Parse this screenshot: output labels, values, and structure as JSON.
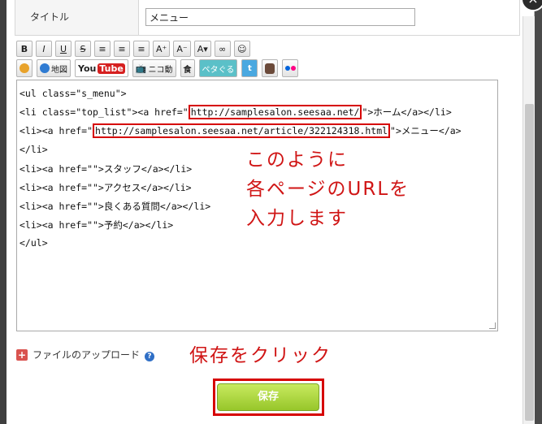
{
  "title_field": {
    "label": "タイトル",
    "value": "メニュー"
  },
  "toolbar": {
    "row1": [
      {
        "name": "bold-button",
        "label": "B",
        "cls": "bold"
      },
      {
        "name": "italic-button",
        "label": "I",
        "cls": "italic"
      },
      {
        "name": "underline-button",
        "label": "U",
        "cls": "underline"
      },
      {
        "name": "strikethrough-button",
        "label": "S",
        "cls": "strike"
      },
      {
        "name": "align-left-button",
        "label": "≡",
        "cls": ""
      },
      {
        "name": "align-center-button",
        "label": "≡",
        "cls": ""
      },
      {
        "name": "align-right-button",
        "label": "≡",
        "cls": ""
      },
      {
        "name": "font-size-up-button",
        "label": "A⁺",
        "cls": ""
      },
      {
        "name": "font-size-down-button",
        "label": "A⁻",
        "cls": ""
      },
      {
        "name": "font-color-button",
        "label": "A▾",
        "cls": ""
      },
      {
        "name": "link-button",
        "label": "∞",
        "cls": ""
      },
      {
        "name": "emoji-button",
        "label": "☺",
        "cls": ""
      }
    ],
    "row2": {
      "ribbon_icon": "award-ribbon-icon",
      "map_label": "地図",
      "youtube_you": "You",
      "youtube_tube": "Tube",
      "nicovideo_label": "ニコ動",
      "food_label": "食",
      "petagogu_label": "ペタぐる",
      "twitter_icon": "t",
      "instagram_icon": "instagram-icon",
      "flickr_icon": "flickr-icon"
    }
  },
  "editor": {
    "lines": [
      "<ul class=\"s_menu\">",
      "<li class=\"top_list\"><a href=\"http://samplesalon.seesaa.net/\">ホーム</a></li>",
      "<li><a href=\"http://samplesalon.seesaa.net/article/322124318.html\">メニュー</a>",
      "</li>",
      "<li><a href=\"\">スタッフ</a></li>",
      "<li><a href=\"\">アクセス</a></li>",
      "<li><a href=\"\">良くある質問</a></li>",
      "<li><a href=\"\">予約</a></li>",
      "</ul>"
    ],
    "line2_prefix": "<li class=\"top_list\"><a href=\"",
    "line2_url": "http://samplesalon.seesaa.net/",
    "line2_suffix": "\">ホーム</a></li>",
    "line3_prefix": "<li><a href=\"",
    "line3_url": "http://samplesalon.seesaa.net/article/322124318.html",
    "line3_suffix": "\">メニュー</a>"
  },
  "annotations": {
    "url_note_1": "このように",
    "url_note_2": "各ページのURLを",
    "url_note_3": "入力します",
    "save_note": "保存をクリック"
  },
  "upload": {
    "label": "ファイルのアップロード",
    "help": "?"
  },
  "save_label": "保存",
  "close_label": "×"
}
